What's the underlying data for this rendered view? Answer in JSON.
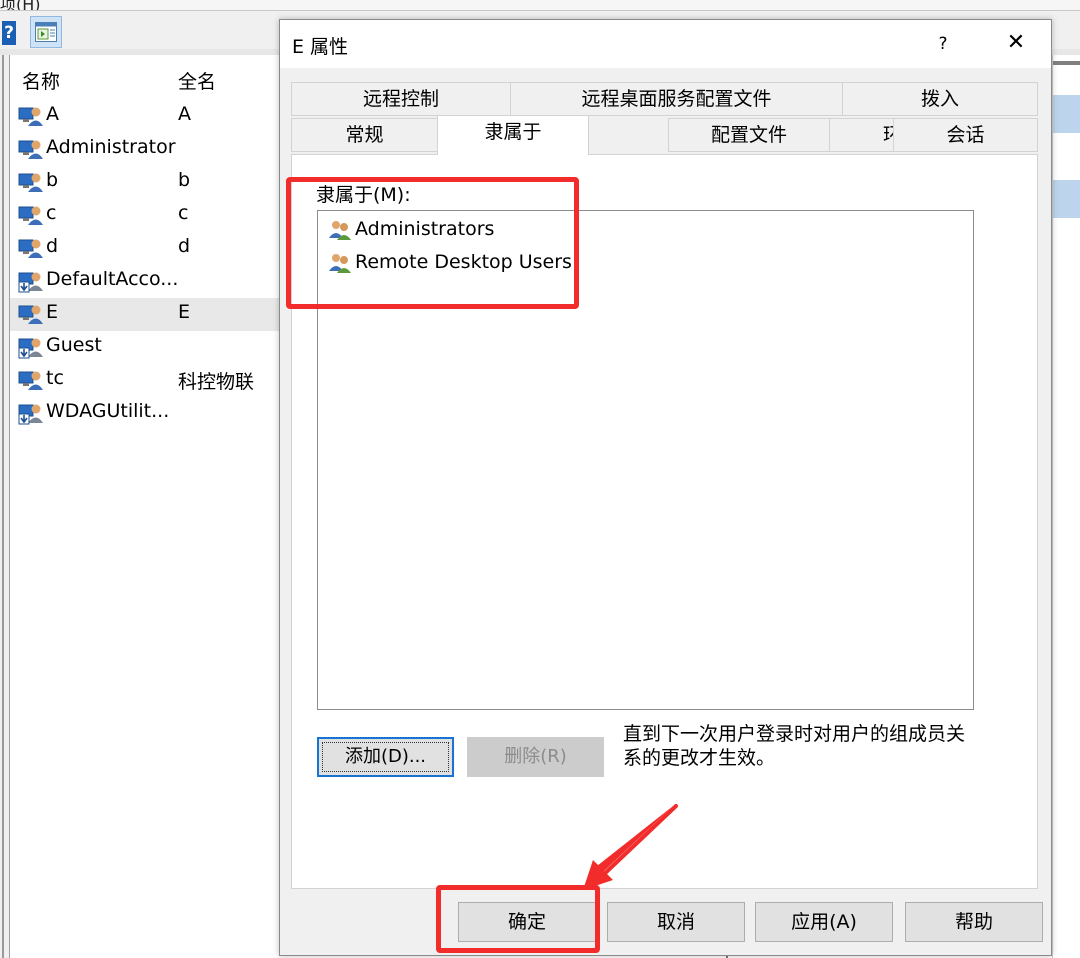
{
  "background": {
    "menu_fragment": "项(H)",
    "columns": {
      "name": "名称",
      "fullname": "全名"
    },
    "users": [
      {
        "name": "A",
        "full": "A",
        "icon": "user-icon"
      },
      {
        "name": "Administrator",
        "full": "",
        "icon": "user-icon"
      },
      {
        "name": "b",
        "full": "b",
        "icon": "user-icon"
      },
      {
        "name": "c",
        "full": "c",
        "icon": "user-icon"
      },
      {
        "name": "d",
        "full": "d",
        "icon": "user-icon"
      },
      {
        "name": "DefaultAcco...",
        "full": "",
        "icon": "disabled-user-icon"
      },
      {
        "name": "E",
        "full": "E",
        "icon": "user-icon",
        "selected": true
      },
      {
        "name": "Guest",
        "full": "",
        "icon": "disabled-user-icon"
      },
      {
        "name": "tc",
        "full": "科控物联",
        "icon": "user-icon"
      },
      {
        "name": "WDAGUtilit...",
        "full": "",
        "icon": "disabled-user-icon"
      }
    ]
  },
  "dialog": {
    "title": "E 属性",
    "help": "?",
    "close": "✕",
    "tabs_row1": [
      "远程控制",
      "远程桌面服务配置文件",
      "拨入"
    ],
    "tabs_row2": [
      "常规",
      "隶属于",
      "配置文件",
      "环境",
      "会话"
    ],
    "active_tab": "隶属于",
    "member_of_label": "隶属于(M):",
    "groups": [
      "Administrators",
      "Remote Desktop Users"
    ],
    "add_button": "添加(D)...",
    "remove_button": "删除(R)",
    "note": "直到下一次用户登录时对用户的组成员关系的更改才生效。",
    "buttons": {
      "ok": "确定",
      "cancel": "取消",
      "apply": "应用(A)",
      "help": "帮助"
    }
  },
  "colors": {
    "annotation_red": "#f22b2b",
    "focus_blue": "#1874d2",
    "selection_gray": "#e8e8e8"
  }
}
